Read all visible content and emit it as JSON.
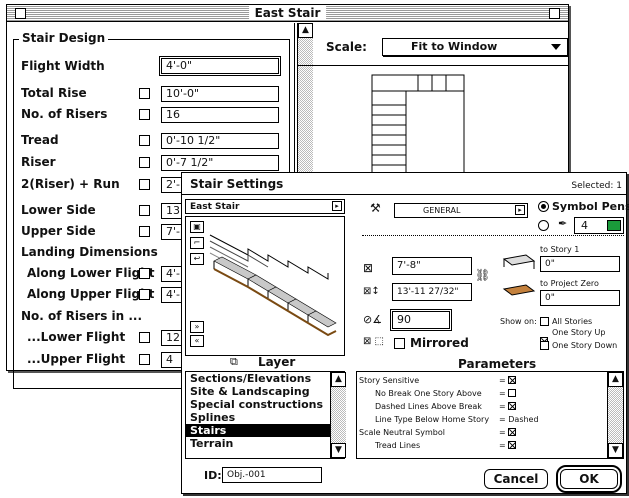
{
  "east_window": {
    "title": "East Stair",
    "group_title": "Stair Design",
    "fields": {
      "flight_width": {
        "label": "Flight Width",
        "value": "4'-0\""
      },
      "total_rise": {
        "label": "Total Rise",
        "value": "10'-0\""
      },
      "no_of_risers": {
        "label": "No. of Risers",
        "value": "16"
      },
      "tread": {
        "label": "Tread",
        "value": "0'-10 1/2\""
      },
      "riser": {
        "label": "Riser",
        "value": "0'-7 1/2\""
      },
      "two_riser_run": {
        "label": "2(Riser) + Run",
        "value": "2'-"
      },
      "lower_side": {
        "label": "Lower Side",
        "value": "13"
      },
      "upper_side": {
        "label": "Upper Side",
        "value": "7'-"
      }
    },
    "landing_header": "Landing Dimensions",
    "along_lower": {
      "label": "Along Lower Flight",
      "value": "4'-"
    },
    "along_upper": {
      "label": "Along Upper Flight",
      "value": "4'-"
    },
    "risers_in_header": "No. of Risers in ...",
    "lower_flight": {
      "label": "...Lower Flight",
      "value": "12"
    },
    "upper_flight": {
      "label": "...Upper Flight",
      "value": "4"
    },
    "scale_label": "Scale:",
    "scale_value": "Fit to Window"
  },
  "settings": {
    "title": "Stair Settings",
    "selected": "Selected: 1",
    "stair_name": "East Stair",
    "layer_select": "GENERAL",
    "symbol_pens": "Symbol Pens",
    "pen_number": "4",
    "pen_color": "#1a9a3a",
    "length_value": "7'-8\"",
    "width_value": "13'-11 27/32\"",
    "angle_value": "90",
    "mirrored_label": "Mirrored",
    "to_story_label": "to Story 1",
    "to_story_value": "0\"",
    "to_project_zero_label": "to Project Zero",
    "to_project_zero_value": "0\"",
    "show_on_label": "Show on:",
    "show_on": {
      "all_stories": "All Stories",
      "one_up": "One Story Up",
      "one_down": "One Story Down"
    },
    "layer_header": "Layer",
    "parameters_header": "Parameters",
    "layers": [
      "Sections/Elevations",
      "Site & Landscaping",
      "Special constructions",
      "Splines",
      "Stairs",
      "Terrain"
    ],
    "selected_layer_index": 4,
    "parameters": [
      {
        "name": "Story Sensitive",
        "value": "",
        "checked": true,
        "indent": 0
      },
      {
        "name": "No Break One Story Above",
        "value": "",
        "checked": false,
        "indent": 1
      },
      {
        "name": "Dashed Lines Above Break",
        "value": "",
        "checked": true,
        "indent": 1
      },
      {
        "name": "Line Type Below Home Story",
        "value": "Dashed",
        "checked": null,
        "indent": 1
      },
      {
        "name": "Scale Neutral Symbol",
        "value": "",
        "checked": true,
        "indent": 0
      },
      {
        "name": "Tread Lines",
        "value": "",
        "checked": true,
        "indent": 1
      }
    ],
    "id_label": "ID:",
    "id_value": "Obj.-001",
    "cancel_label": "Cancel",
    "ok_label": "OK"
  }
}
